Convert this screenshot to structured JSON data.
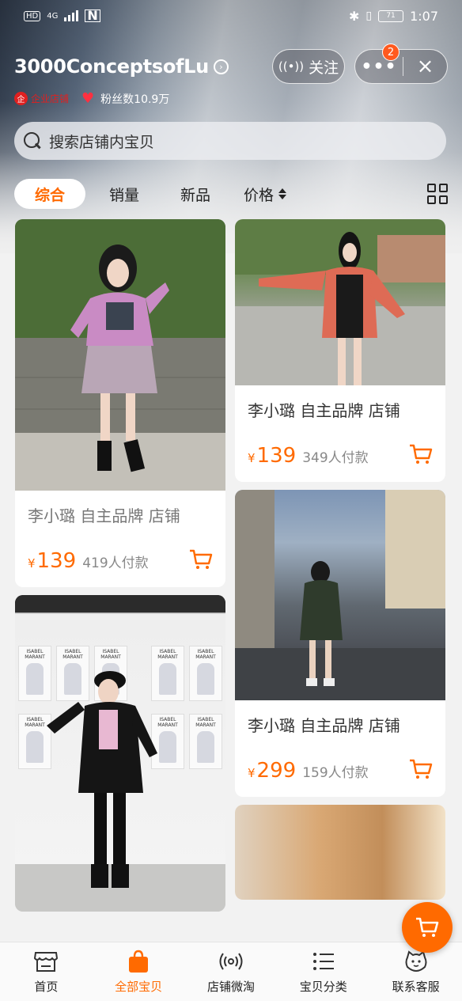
{
  "status_bar": {
    "left": [
      "HD",
      "4G"
    ],
    "time": "1:07",
    "battery": "71"
  },
  "store": {
    "name": "3000ConceptsofLu",
    "business_tag": "企业店铺",
    "fans": "粉丝数10.9万",
    "follow_label": "关注",
    "badge_count": "2"
  },
  "search": {
    "placeholder": "搜索店铺内宝贝"
  },
  "sort_tabs": [
    "综合",
    "销量",
    "新品",
    "价格"
  ],
  "products": [
    {
      "title": "李小璐 自主品牌 店铺",
      "currency": "¥",
      "price": "139",
      "sold": "419人付款"
    },
    {
      "title": "李小璐 自主品牌 店铺",
      "currency": "¥",
      "price": "139",
      "sold": "349人付款"
    },
    {
      "title": "李小璐 自主品牌 店铺",
      "currency": "¥",
      "price": "299",
      "sold": "159人付款"
    }
  ],
  "poster_text": "ISABEL MARANT",
  "bottom_nav": [
    {
      "label": "首页",
      "icon": "store-icon"
    },
    {
      "label": "全部宝贝",
      "icon": "shopping-bag-icon"
    },
    {
      "label": "店铺微淘",
      "icon": "broadcast-icon"
    },
    {
      "label": "宝贝分类",
      "icon": "category-list-icon"
    },
    {
      "label": "联系客服",
      "icon": "customer-service-icon"
    }
  ],
  "colors": {
    "accent": "#ff6a00",
    "badge": "#ff5a1f",
    "business": "#e02020",
    "heart": "#ff3040"
  }
}
